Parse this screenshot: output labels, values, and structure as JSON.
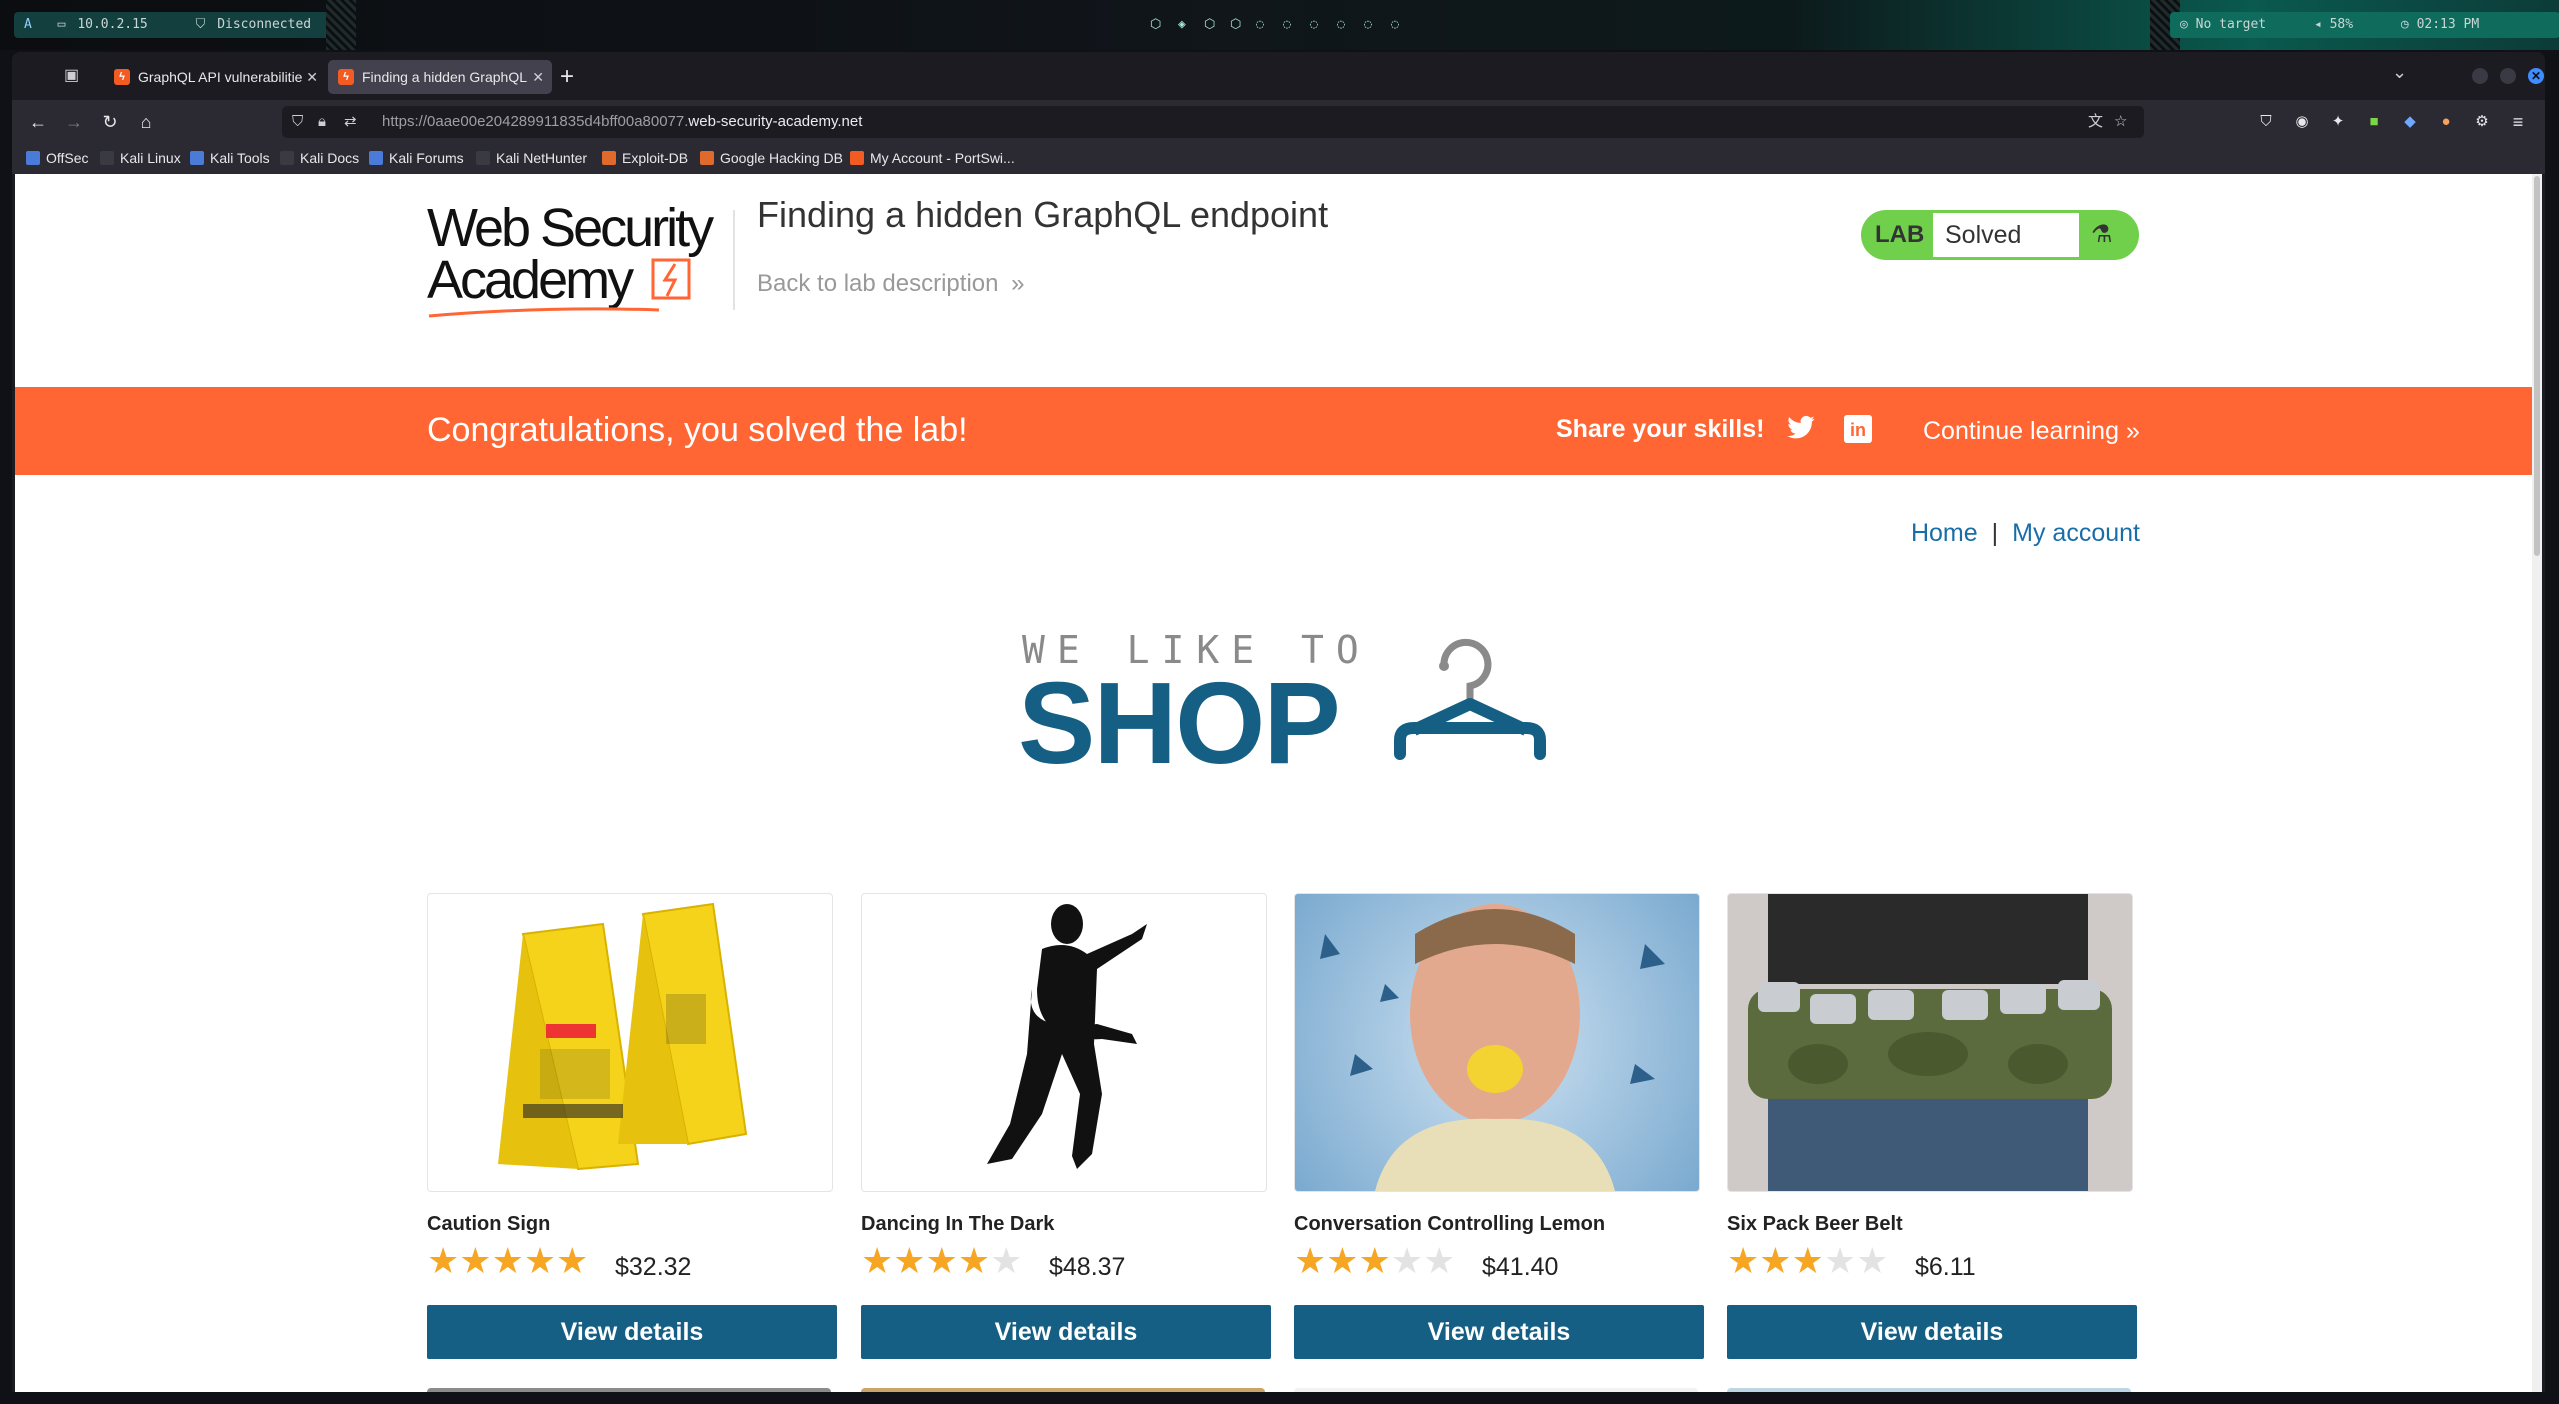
{
  "system": {
    "left_status": [
      "10.0.2.15",
      "Disconnected"
    ],
    "workspace_icons": [
      "app-icon-1",
      "app-icon-2",
      "app-icon-3",
      "app-icon-4",
      "app-icon-5",
      "app-icon-6",
      "app-icon-7",
      "app-icon-8",
      "app-icon-9"
    ],
    "right_status": [
      "No target",
      "58%",
      "02:13 PM"
    ]
  },
  "browser": {
    "tabs": [
      {
        "label": "GraphQL API vulnerabilitie",
        "active": false
      },
      {
        "label": "Finding a hidden GraphQL",
        "active": true
      }
    ],
    "url_prefix": "https://0aae00e204289911835d4bff00a80077.",
    "url_domain": "web-security-academy.net",
    "bookmarks": [
      "OffSec",
      "Kali Linux",
      "Kali Tools",
      "Kali Docs",
      "Kali Forums",
      "Kali NetHunter",
      "Exploit-DB",
      "Google Hacking DB",
      "My Account - PortSwi..."
    ]
  },
  "page": {
    "logo": {
      "line1": "Web Security",
      "line2": "Academy"
    },
    "lab_title": "Finding a hidden GraphQL endpoint",
    "back_link": "Back to lab description",
    "lab_status": {
      "label": "LAB",
      "value": "Solved"
    },
    "banner": {
      "message": "Congratulations, you solved the lab!",
      "share": "Share your skills!",
      "continue": "Continue learning"
    },
    "nav": {
      "home": "Home",
      "separator": "|",
      "account": "My account"
    },
    "shop_logo": {
      "tagline": "WE LIKE TO",
      "word": "SHOP"
    },
    "products": [
      {
        "name": "Caution Sign",
        "stars": 5,
        "price": "$32.32",
        "button": "View details"
      },
      {
        "name": "Dancing In The Dark",
        "stars": 4,
        "price": "$48.37",
        "button": "View details"
      },
      {
        "name": "Conversation Controlling Lemon",
        "stars": 3,
        "price": "$41.40",
        "button": "View details"
      },
      {
        "name": "Six Pack Beer Belt",
        "stars": 3,
        "price": "$6.11",
        "button": "View details"
      }
    ]
  }
}
